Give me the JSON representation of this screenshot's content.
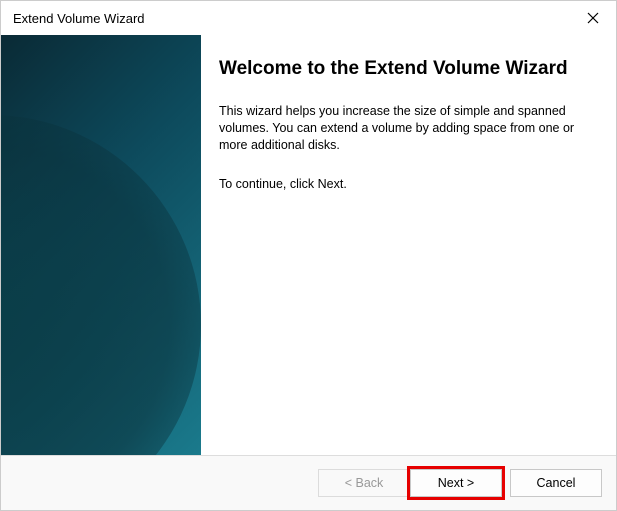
{
  "titlebar": {
    "title": "Extend Volume Wizard"
  },
  "main": {
    "heading": "Welcome to the Extend Volume Wizard",
    "body": "This wizard helps you increase the size of simple and spanned volumes. You can extend a volume  by adding space from one or more additional disks.",
    "continue_text": "To continue, click Next."
  },
  "buttons": {
    "back_label": "< Back",
    "next_label": "Next >",
    "cancel_label": "Cancel"
  }
}
